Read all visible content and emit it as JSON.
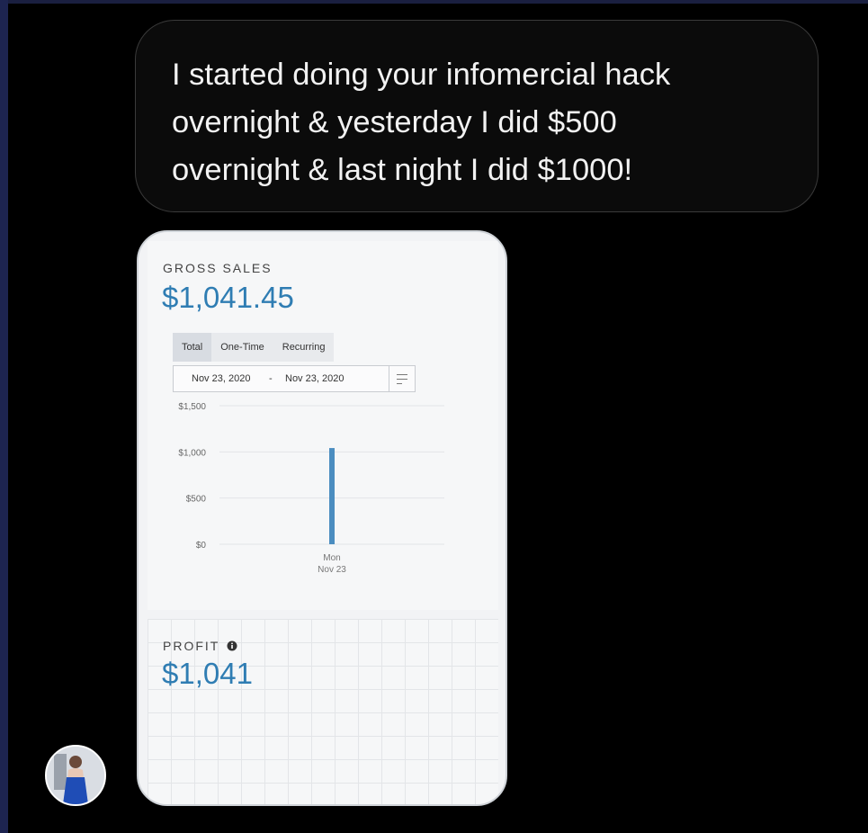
{
  "message": {
    "lines": [
      "I started doing your infomercial hack",
      "overnight & yesterday I did $500",
      "overnight & last night I did $1000!"
    ]
  },
  "gross_sales": {
    "label": "GROSS SALES",
    "value": "$1,041.45",
    "tabs": [
      "Total",
      "One-Time",
      "Recurring"
    ],
    "active_tab": "Total",
    "date_from": "Nov 23, 2020",
    "date_sep": "-",
    "date_to": "Nov 23, 2020"
  },
  "profit": {
    "label": "PROFIT",
    "info_icon": "info-icon",
    "value": "$1,041"
  },
  "chart_data": {
    "type": "bar",
    "categories": [
      "Mon Nov 23"
    ],
    "x_tick_lines": [
      [
        "Mon",
        "Nov 23"
      ]
    ],
    "values": [
      1041.45
    ],
    "yticks": [
      "$1,500",
      "$1,000",
      "$500",
      "$0"
    ],
    "ytick_values": [
      1500,
      1000,
      500,
      0
    ],
    "ylim": [
      0,
      1500
    ],
    "grid": true,
    "bar_color": "#4b8dc0"
  },
  "colors": {
    "accent": "#2f7db3",
    "bubble_text": "#f2f2f2",
    "background": "#000000"
  },
  "avatar": {
    "icon": "profile-photo"
  }
}
